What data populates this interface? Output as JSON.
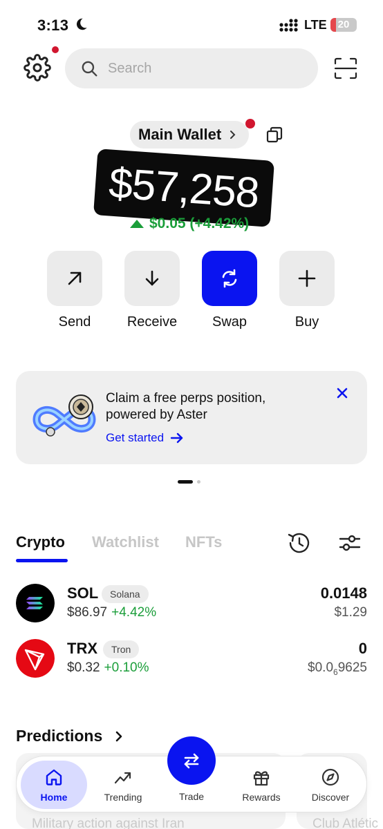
{
  "status_bar": {
    "time": "3:13",
    "network": "LTE",
    "battery": "20",
    "battery_level": 0.2
  },
  "search": {
    "placeholder": "Search"
  },
  "wallet": {
    "name": "Main Wallet",
    "balance": "$57,258",
    "change": "$0.05 (+4.42%)"
  },
  "actions": [
    {
      "label": "Send",
      "icon": "arrow-up-right-icon"
    },
    {
      "label": "Receive",
      "icon": "arrow-down-icon"
    },
    {
      "label": "Swap",
      "icon": "swap-icon"
    },
    {
      "label": "Buy",
      "icon": "plus-icon"
    }
  ],
  "promo": {
    "line1": "Claim a free perps position,",
    "line2": "powered by Aster",
    "cta": "Get started"
  },
  "tabs": [
    "Crypto",
    "Watchlist",
    "NFTs"
  ],
  "tokens": [
    {
      "symbol": "SOL",
      "chain": "Solana",
      "price": "$86.97",
      "change": "+4.42%",
      "amount": "0.0148",
      "value": "$1.29"
    },
    {
      "symbol": "TRX",
      "chain": "Tron",
      "price": "$0.32",
      "change": "+0.10%",
      "amount": "0",
      "value_prefix": "$0.0",
      "value_sub": "6",
      "value_suffix": "9625"
    }
  ],
  "predictions": {
    "title": "Predictions",
    "items": [
      "Military action against Iran",
      "Club Atlétic"
    ]
  },
  "nav": {
    "home": "Home",
    "trending": "Trending",
    "trade": "Trade",
    "rewards": "Rewards",
    "discover": "Discover"
  },
  "colors": {
    "accent": "#0a14f0",
    "positive": "#1b9e3a",
    "alert_dot": "#d1162f"
  }
}
